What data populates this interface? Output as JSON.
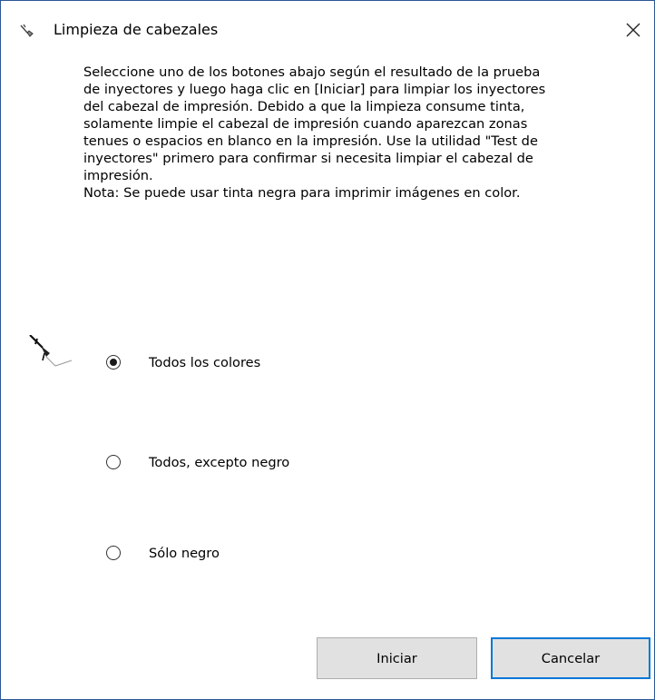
{
  "window": {
    "title": "Limpieza de cabezales",
    "title_icon": "printer-brush-icon",
    "close_icon": "close-icon"
  },
  "description_lines": [
    "Seleccione uno de los botones abajo según el resultado de la prueba",
    "de inyectores y luego haga clic en [Iniciar] para limpiar los inyectores",
    "del cabezal de impresión. Debido a que la limpieza consume tinta,",
    "solamente limpie el cabezal de impresión cuando aparezcan zonas",
    "tenues o espacios en blanco en la impresión. Use la utilidad \"Test de",
    "inyectores\" primero para confirmar si necesita limpiar el cabezal de",
    "impresión.",
    "Nota: Se puede usar tinta negra para imprimir imágenes en color."
  ],
  "options": [
    {
      "label": "Todos los colores",
      "selected": true
    },
    {
      "label": "Todos, excepto negro",
      "selected": false
    },
    {
      "label": "Sólo negro",
      "selected": false
    }
  ],
  "buttons": {
    "start": "Iniciar",
    "cancel": "Cancelar"
  },
  "colors": {
    "window_border": "#2b5797",
    "button_focus": "#0078d7",
    "button_bg": "#e1e1e1"
  }
}
